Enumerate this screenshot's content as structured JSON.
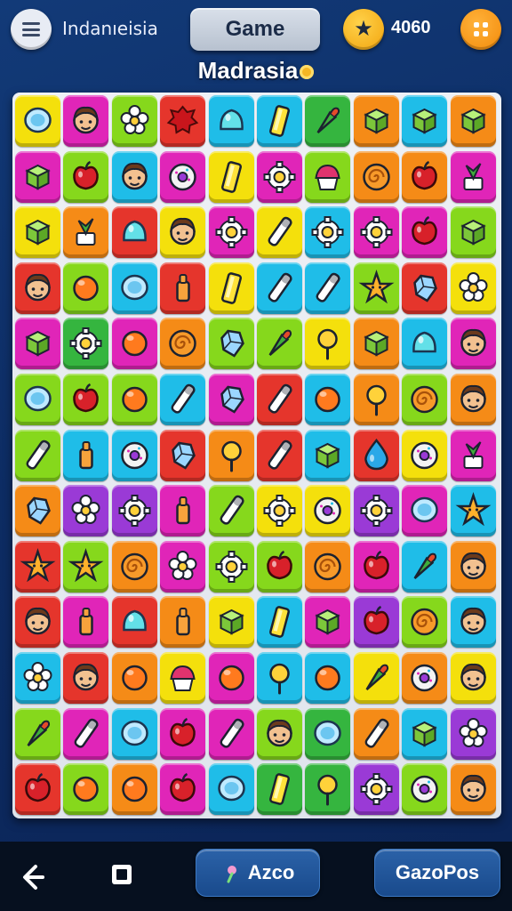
{
  "header": {
    "region_label": "Indanıeisia",
    "game_button": "Game",
    "score": "4060",
    "level_title": "Madrasia"
  },
  "board": {
    "columns": 10,
    "rows": 13,
    "tiles": [
      [
        "yellow:disc",
        "magenta:face",
        "lime:flower",
        "red:splash",
        "cyan:blob",
        "cyan:bar",
        "green:carrot",
        "orange:box",
        "cyan:box",
        "orange:box"
      ],
      [
        "magenta:box",
        "lime:apple",
        "cyan:face",
        "magenta:donut",
        "yellow:bar",
        "magenta:gear",
        "lime:cake",
        "orange:swirl",
        "orange:apple",
        "magenta:leaf"
      ],
      [
        "yellow:box",
        "orange:leaf",
        "red:blob",
        "yellow:face",
        "magenta:gear",
        "yellow:wand",
        "cyan:gear",
        "magenta:gear",
        "magenta:apple",
        "lime:box"
      ],
      [
        "red:face",
        "lime:ball",
        "cyan:disc",
        "red:bottle",
        "yellow:bar",
        "cyan:wand",
        "cyan:wand",
        "lime:star",
        "red:gem",
        "yellow:flower"
      ],
      [
        "magenta:box",
        "green:gear",
        "magenta:ball",
        "orange:swirl",
        "lime:gem",
        "lime:carrot",
        "yellow:lolly",
        "orange:box",
        "cyan:blob",
        "magenta:face"
      ],
      [
        "lime:disc",
        "lime:apple",
        "lime:ball",
        "cyan:wand",
        "magenta:gem",
        "red:wand",
        "cyan:ball",
        "orange:lolly",
        "lime:swirl",
        "orange:face"
      ],
      [
        "lime:wand",
        "cyan:bottle",
        "cyan:donut",
        "red:gem",
        "orange:lolly",
        "red:wand",
        "cyan:box",
        "red:drop",
        "yellow:donut",
        "magenta:leaf"
      ],
      [
        "orange:gem",
        "purple:flower",
        "purple:gear",
        "magenta:bottle",
        "lime:wand",
        "yellow:gear",
        "yellow:donut",
        "purple:gear",
        "magenta:disc",
        "cyan:star"
      ],
      [
        "red:star",
        "lime:star",
        "orange:swirl",
        "magenta:flower",
        "lime:gear",
        "lime:apple",
        "orange:swirl",
        "magenta:apple",
        "cyan:carrot",
        "orange:face"
      ],
      [
        "red:face",
        "magenta:bottle",
        "red:blob",
        "orange:bottle",
        "yellow:box",
        "cyan:bar",
        "magenta:box",
        "purple:apple",
        "lime:swirl",
        "cyan:face"
      ],
      [
        "cyan:flower",
        "red:face",
        "orange:ball",
        "yellow:cake",
        "magenta:ball",
        "cyan:lolly",
        "cyan:ball",
        "yellow:carrot",
        "orange:donut",
        "yellow:face"
      ],
      [
        "lime:carrot",
        "magenta:wand",
        "cyan:disc",
        "magenta:apple",
        "magenta:wand",
        "lime:face",
        "green:disc",
        "orange:wand",
        "cyan:box",
        "purple:flower"
      ],
      [
        "red:apple",
        "lime:ball",
        "orange:ball",
        "magenta:apple",
        "cyan:disc",
        "green:bar",
        "green:lolly",
        "purple:gear",
        "lime:donut",
        "orange:face"
      ]
    ]
  },
  "palette": {
    "yellow": "#f4e00c",
    "lime": "#86d81c",
    "green": "#35b53f",
    "cyan": "#1fbde8",
    "magenta": "#e025b8",
    "purple": "#9a3ad6",
    "orange": "#f58b17",
    "red": "#e5352c"
  },
  "icons": {
    "menu": "menu-icon",
    "star": "star-icon",
    "apps": "apps-grid-icon",
    "back": "back-arrow-icon",
    "square": "square-icon",
    "flower": "flower-icon"
  },
  "footer": {
    "button_a": "Azco",
    "button_b": "GazoPos"
  }
}
